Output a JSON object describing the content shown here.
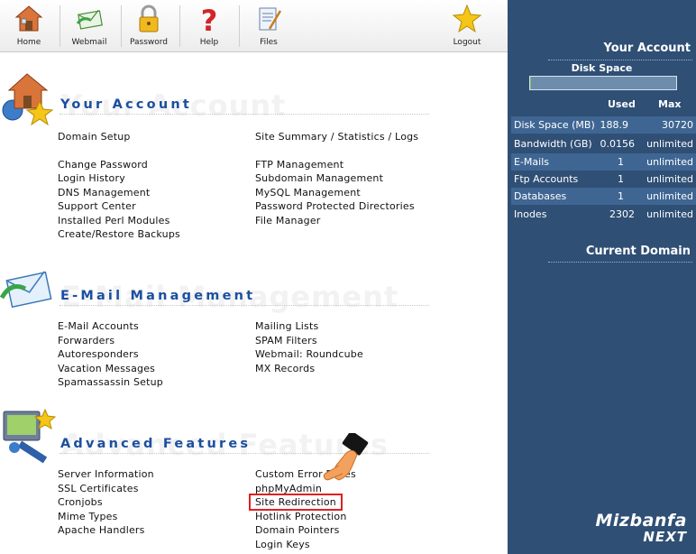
{
  "toolbar": {
    "home": "Home",
    "webmail": "Webmail",
    "password": "Password",
    "help": "Help",
    "files": "Files",
    "logout": "Logout"
  },
  "account": {
    "title": "Your Account",
    "links_left": [
      "Domain Setup",
      "Change Password",
      "Login History",
      "DNS Management",
      "Support Center",
      "Installed Perl Modules",
      "Create/Restore Backups"
    ],
    "links_right": [
      "Site Summary / Statistics / Logs",
      "FTP Management",
      "Subdomain Management",
      "MySQL Management",
      "Password Protected Directories",
      "File Manager"
    ]
  },
  "email": {
    "title": "E-Mail Management",
    "links_left": [
      "E-Mail Accounts",
      "Forwarders",
      "Autoresponders",
      "Vacation Messages",
      "Spamassassin Setup"
    ],
    "links_right": [
      "Mailing Lists",
      "SPAM Filters",
      "Webmail: Roundcube",
      "MX Records"
    ]
  },
  "advanced": {
    "title": "Advanced Features",
    "links_left": [
      "Server Information",
      "SSL Certificates",
      "Cronjobs",
      "Mime Types",
      "Apache Handlers"
    ],
    "links_right": [
      "Custom Error Pages",
      "phpMyAdmin",
      "Site Redirection",
      "Hotlink Protection",
      "Domain Pointers",
      "Login Keys"
    ]
  },
  "sidebar": {
    "title": "Your Account",
    "disk_space_label": "Disk Space",
    "disk_usage_fraction": 0.006,
    "col_used": "Used",
    "col_max": "Max",
    "stats": [
      {
        "label": "Disk Space (MB)",
        "used": "188.9",
        "max": "30720"
      },
      {
        "label": "Bandwidth (GB)",
        "used": "0.0156",
        "max": "unlimited"
      },
      {
        "label": "E-Mails",
        "used": "1",
        "max": "unlimited"
      },
      {
        "label": "Ftp Accounts",
        "used": "1",
        "max": "unlimited"
      },
      {
        "label": "Databases",
        "used": "1",
        "max": "unlimited"
      },
      {
        "label": "Inodes",
        "used": "2302",
        "max": "unlimited"
      }
    ],
    "current_domain": "Current Domain"
  },
  "brand": {
    "line1": "Mizbanfa",
    "line2": "NEXT"
  },
  "colors": {
    "accent": "#1c4fa0",
    "sidebar": "#2f4f75",
    "highlight": "#e02020"
  }
}
